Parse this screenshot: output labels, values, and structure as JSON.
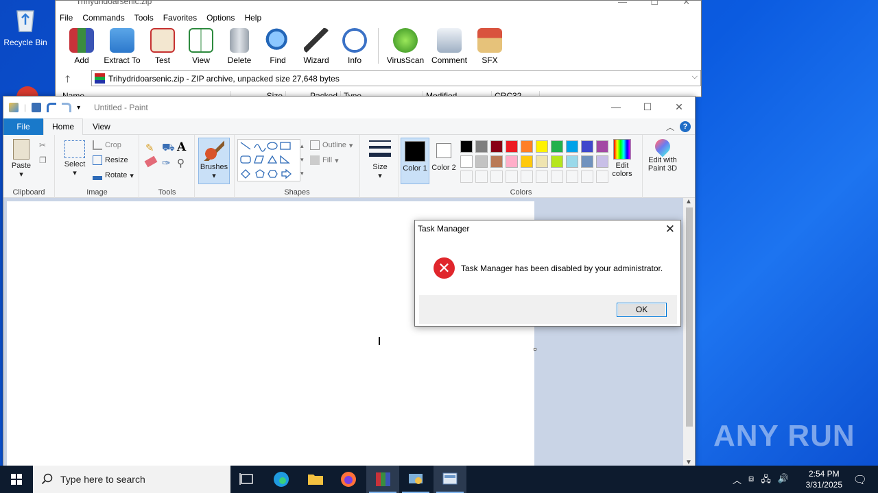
{
  "desktop": {
    "icons": [
      {
        "label": "Recycle Bin",
        "icon": "recycle-bin-icon"
      }
    ]
  },
  "winrar": {
    "title": "Trihydridoarsenic.zip",
    "menu": [
      "File",
      "Commands",
      "Tools",
      "Favorites",
      "Options",
      "Help"
    ],
    "toolbar": [
      "Add",
      "Extract To",
      "Test",
      "View",
      "Delete",
      "Find",
      "Wizard",
      "Info",
      "VirusScan",
      "Comment",
      "SFX"
    ],
    "address": "Trihydridoarsenic.zip - ZIP archive, unpacked size 27,648 bytes",
    "columns": [
      "Name",
      "Size",
      "Packed",
      "Type",
      "Modified",
      "CRC32"
    ]
  },
  "paint": {
    "title": "Untitled - Paint",
    "tabs": {
      "file": "File",
      "home": "Home",
      "view": "View"
    },
    "groups": {
      "clipboard": {
        "label": "Clipboard",
        "paste": "Paste"
      },
      "image": {
        "label": "Image",
        "select": "Select",
        "crop": "Crop",
        "resize": "Resize",
        "rotate": "Rotate"
      },
      "tools": {
        "label": "Tools"
      },
      "brushes": {
        "label": "Brushes"
      },
      "shapes": {
        "label": "Shapes",
        "outline": "Outline",
        "fill": "Fill"
      },
      "size": {
        "label": "Size"
      },
      "colors": {
        "label": "Colors",
        "color1": "Color 1",
        "color2": "Color 2",
        "edit": "Edit colors",
        "paint3d": "Edit with Paint 3D",
        "palette_row1": [
          "#000000",
          "#7f7f7f",
          "#880015",
          "#ed1c24",
          "#ff7f27",
          "#fff200",
          "#22b14c",
          "#00a2e8",
          "#3f48cc",
          "#a349a4"
        ],
        "palette_row2": [
          "#ffffff",
          "#c3c3c3",
          "#b97a57",
          "#ffaec9",
          "#ffc90e",
          "#efe4b0",
          "#b5e61d",
          "#99d9ea",
          "#7092be",
          "#c8bfe7"
        ]
      }
    }
  },
  "dialog": {
    "title": "Task Manager",
    "message": "Task Manager has been disabled by your administrator.",
    "ok": "OK"
  },
  "taskbar": {
    "search_placeholder": "Type here to search",
    "time": "2:54 PM",
    "date": "3/31/2025"
  },
  "watermark": "ANY RUN"
}
